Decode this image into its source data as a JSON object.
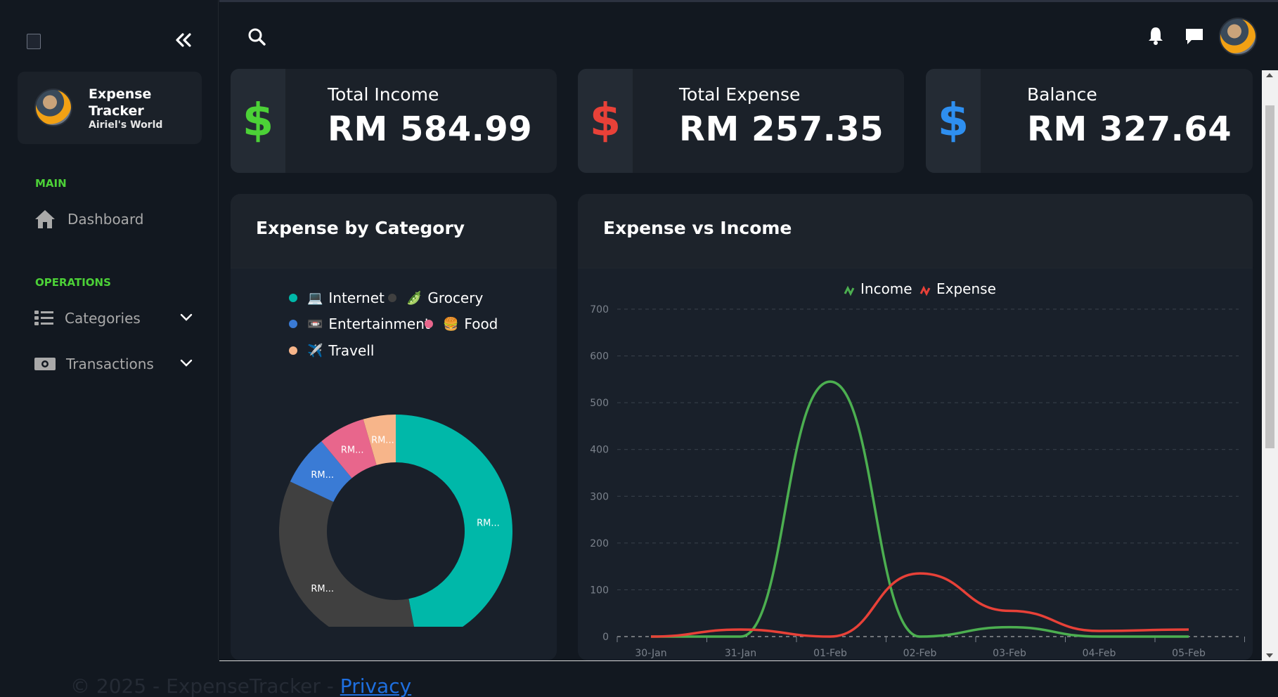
{
  "app": {
    "name_line1": "Expense",
    "name_line2": "Tracker",
    "subtitle": "Airiel's World"
  },
  "sidebar": {
    "main_label": "MAIN",
    "operations_label": "OPERATIONS",
    "items": [
      {
        "label": "Dashboard",
        "icon": "home-icon"
      },
      {
        "label": "Categories",
        "icon": "list-icon"
      },
      {
        "label": "Transactions",
        "icon": "money-icon"
      }
    ]
  },
  "cards": [
    {
      "title": "Total Income",
      "value": "RM 584.99",
      "color": "#4cd137"
    },
    {
      "title": "Total Expense",
      "value": "RM 257.35",
      "color": "#e84138"
    },
    {
      "title": "Balance",
      "value": "RM 327.64",
      "color": "#2e8ff0"
    }
  ],
  "category_panel": {
    "title": "Expense by Category",
    "legend": [
      {
        "label": "Internet",
        "emoji": "💻",
        "color": "#00b8a9"
      },
      {
        "label": "Grocery",
        "emoji": "🫛",
        "color": "#404040"
      },
      {
        "label": "Entertainment",
        "emoji": "📼",
        "color": "#3a7bd5"
      },
      {
        "label": "Food",
        "emoji": "🍔",
        "color": "#e8668c"
      },
      {
        "label": "Travell",
        "emoji": "✈️",
        "color": "#f7b58a"
      }
    ],
    "slice_label": "RM..."
  },
  "chart_panel": {
    "title": "Expense vs Income"
  },
  "chart_data": {
    "type": "line",
    "categories": [
      "30-Jan",
      "31-Jan",
      "01-Feb",
      "02-Feb",
      "03-Feb",
      "04-Feb",
      "05-Feb"
    ],
    "ylim": [
      0,
      700
    ],
    "yticks": [
      0,
      100,
      200,
      300,
      400,
      500,
      600,
      700
    ],
    "series": [
      {
        "name": "Income",
        "color": "#4caf50",
        "values": [
          0,
          0,
          545,
          0,
          20,
          0,
          0
        ]
      },
      {
        "name": "Expense",
        "color": "#e84138",
        "values": [
          0,
          15,
          0,
          135,
          55,
          12,
          15
        ]
      }
    ]
  },
  "pie_data": {
    "type": "pie",
    "labels": [
      "Internet",
      "Grocery",
      "Entertainment",
      "Food",
      "Travell"
    ],
    "values": [
      47,
      35,
      7,
      6.5,
      4.5
    ]
  },
  "footer": {
    "text": "© 2025 - ExpenseTracker - ",
    "link": "Privacy"
  }
}
